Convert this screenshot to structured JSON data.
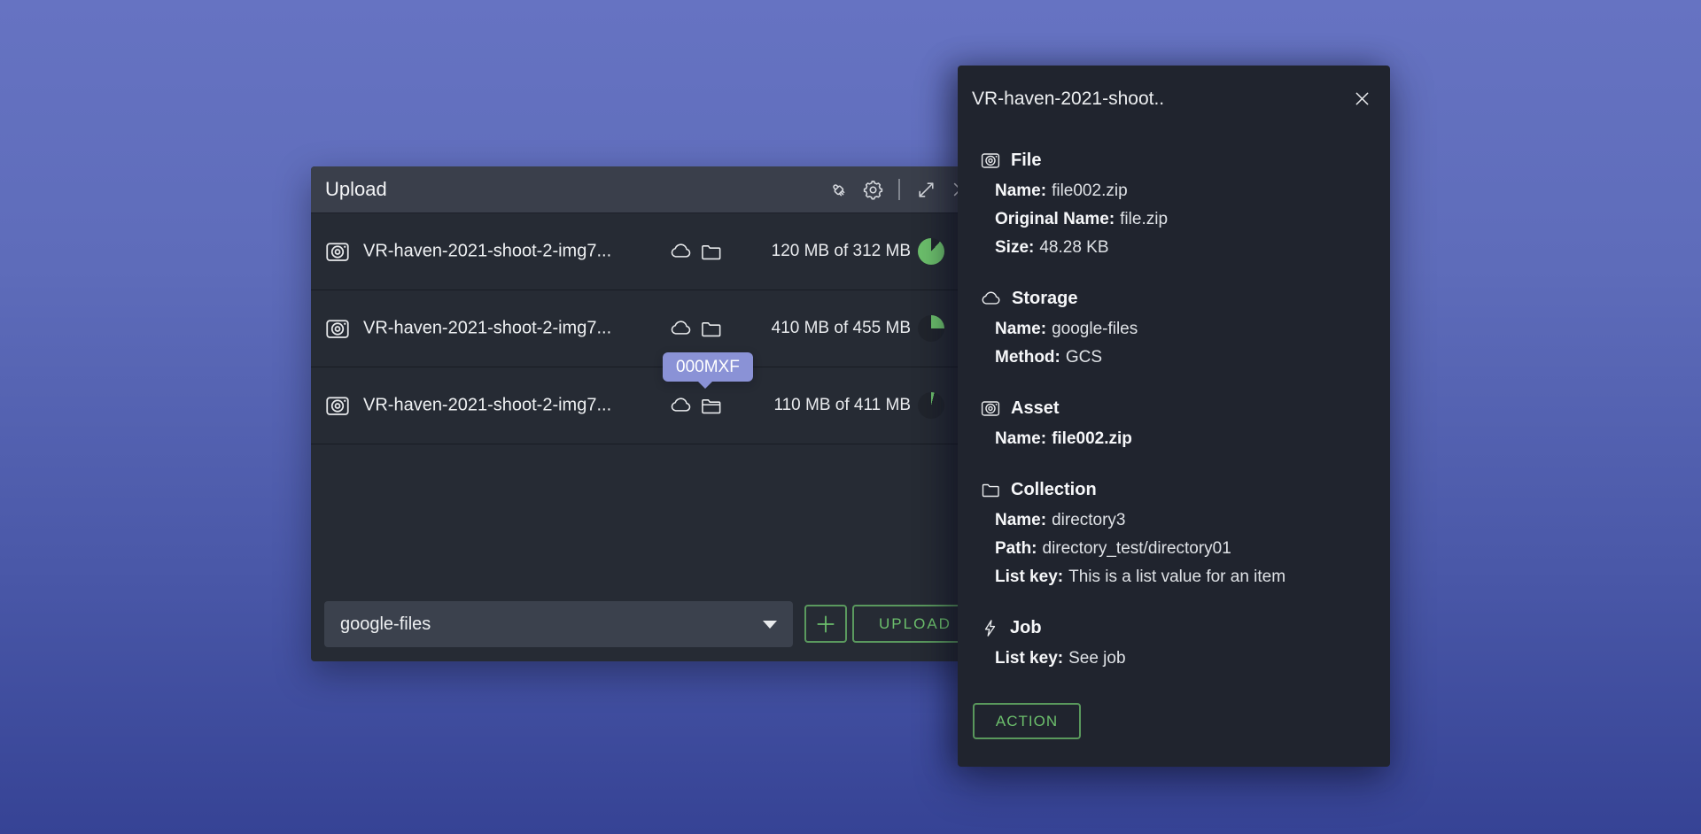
{
  "colors": {
    "green": "#6cbf6c",
    "pie_dark": "#21252d",
    "tooltip_bg": "#8a92d6",
    "titlebar_bg": "#3a3f4b",
    "window_bg": "#262b34",
    "panel_bg": "#20242e"
  },
  "upload_window": {
    "title": "Upload",
    "toolbar": {
      "icons": [
        "clean-brush-icon",
        "settings-gear-icon",
        "expand-icon",
        "close-icon"
      ]
    },
    "rows": [
      {
        "name": "VR-haven-2021-shoot-2-img7...",
        "size": "120 MB of 312 MB",
        "icons": [
          "camera-icon",
          "cloud-icon",
          "folder-icon"
        ],
        "pie": {
          "segments": [
            {
              "c": "pie_dark",
              "from": 0,
              "to": 42
            },
            {
              "c": "green",
              "from": 42,
              "to": 360
            }
          ]
        }
      },
      {
        "name": "VR-haven-2021-shoot-2-img7...",
        "size": "410 MB of 455 MB",
        "icons": [
          "camera-icon",
          "cloud-icon",
          "folder-icon"
        ],
        "pie": {
          "segments": [
            {
              "c": "green",
              "from": 0,
              "to": 90
            },
            {
              "c": "pie_dark",
              "from": 90,
              "to": 360
            }
          ]
        }
      },
      {
        "name": "VR-haven-2021-shoot-2-img7...",
        "size": "110 MB of 411 MB",
        "icons": [
          "camera-icon",
          "cloud-icon",
          "folder-open-icon"
        ],
        "pie": {
          "segments": [
            {
              "c": "green",
              "from": 0,
              "to": 14
            },
            {
              "c": "pie_dark",
              "from": 14,
              "to": 360
            }
          ]
        }
      }
    ],
    "storage_select": {
      "value": "google-files"
    },
    "upload_button_label": "UPLOAD",
    "add_button_icon": "plus-icon"
  },
  "tooltip": {
    "text": "000MXF"
  },
  "detail_panel": {
    "title": "VR-haven-2021-shoot..",
    "sections": [
      {
        "heading": "File",
        "icon": "camera-icon",
        "items": [
          {
            "label": "Name:",
            "value": "file002.zip"
          },
          {
            "label": "Original Name:",
            "value": "file.zip"
          },
          {
            "label": "Size:",
            "value": "48.28 KB"
          }
        ]
      },
      {
        "heading": "Storage",
        "icon": "cloud-icon",
        "items": [
          {
            "label": "Name:",
            "value": "google-files"
          },
          {
            "label": "Method:",
            "value": "GCS"
          }
        ]
      },
      {
        "heading": "Asset",
        "icon": "camera-icon",
        "items": [
          {
            "label": "Name:",
            "value": "file002.zip"
          }
        ]
      },
      {
        "heading": "Collection",
        "icon": "folder-icon",
        "items": [
          {
            "label": "Name:",
            "value": "directory3"
          },
          {
            "label": "Path:",
            "value": "directory_test/directory01"
          },
          {
            "label": "List key:",
            "value": "This is a list value for an item"
          }
        ]
      },
      {
        "heading": "Job",
        "icon": "lightning-icon",
        "items": [
          {
            "label": "List key:",
            "value": "See job"
          }
        ]
      }
    ],
    "action_button_label": "ACTION"
  }
}
